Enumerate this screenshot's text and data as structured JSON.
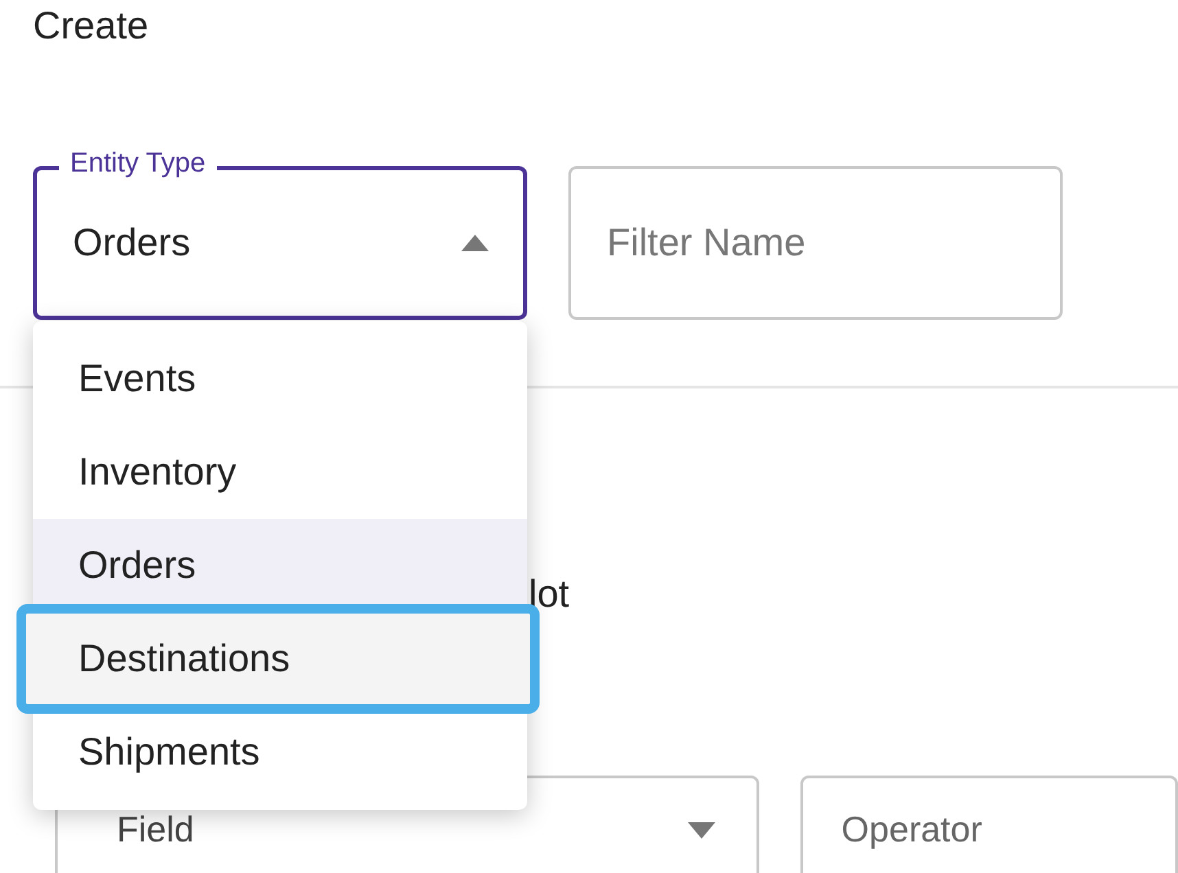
{
  "page": {
    "title": "Create"
  },
  "entity_type": {
    "label": "Entity Type",
    "value": "Orders",
    "expanded": true,
    "options": [
      {
        "label": "Events",
        "selected": false,
        "focused": false
      },
      {
        "label": "Inventory",
        "selected": false,
        "focused": false
      },
      {
        "label": "Orders",
        "selected": true,
        "focused": false
      },
      {
        "label": "Destinations",
        "selected": false,
        "focused": true
      },
      {
        "label": "Shipments",
        "selected": false,
        "focused": false
      }
    ]
  },
  "filter_name": {
    "placeholder": "Filter Name"
  },
  "partial_text": "lot",
  "condition": {
    "field": {
      "placeholder": "Field"
    },
    "operator": {
      "placeholder": "Operator"
    }
  }
}
